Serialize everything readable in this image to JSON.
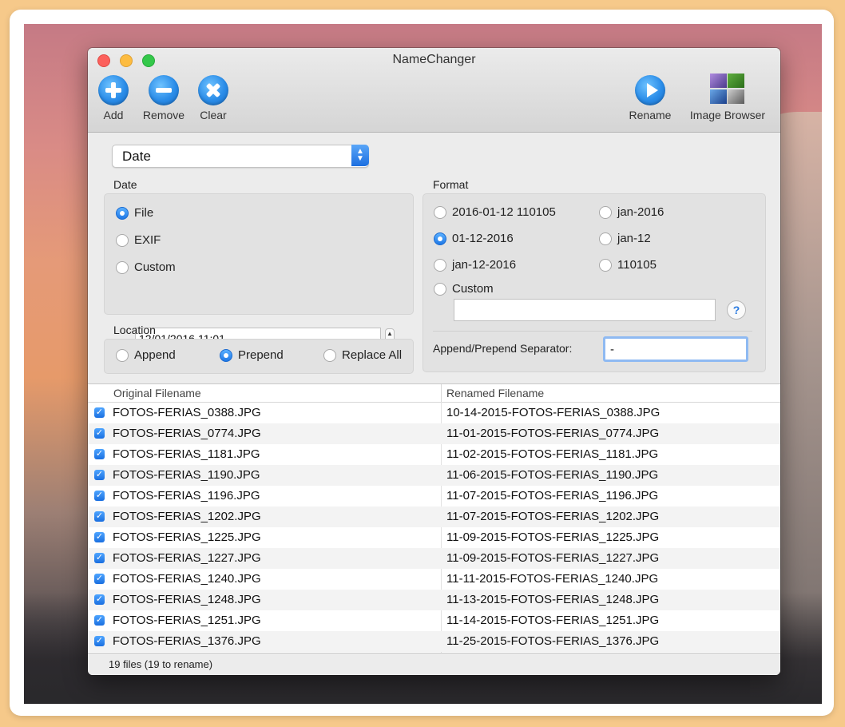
{
  "window": {
    "title": "NameChanger"
  },
  "toolbar": {
    "add": "Add",
    "remove": "Remove",
    "clear": "Clear",
    "rename": "Rename",
    "image_browser": "Image Browser"
  },
  "mode_select": {
    "value": "Date"
  },
  "date_section": {
    "label": "Date",
    "options": [
      "File",
      "EXIF",
      "Custom"
    ],
    "selected": "File",
    "custom_value": "12/01/2016 11:01"
  },
  "location_section": {
    "label": "Location",
    "options": [
      "Append",
      "Prepend",
      "Replace All"
    ],
    "selected": "Prepend"
  },
  "format_section": {
    "label": "Format",
    "options": [
      "2016-01-12 110105",
      "jan-2016",
      "01-12-2016",
      "jan-12",
      "jan-12-2016",
      "110105",
      "Custom"
    ],
    "selected": "01-12-2016",
    "custom_value": "",
    "help": "?"
  },
  "separator": {
    "label": "Append/Prepend Separator:",
    "value": "-"
  },
  "table": {
    "headers": [
      "Original Filename",
      "Renamed Filename"
    ],
    "rows": [
      {
        "original": "FOTOS-FERIAS_0388.JPG",
        "renamed": "10-14-2015-FOTOS-FERIAS_0388.JPG"
      },
      {
        "original": "FOTOS-FERIAS_0774.JPG",
        "renamed": "11-01-2015-FOTOS-FERIAS_0774.JPG"
      },
      {
        "original": "FOTOS-FERIAS_1181.JPG",
        "renamed": "11-02-2015-FOTOS-FERIAS_1181.JPG"
      },
      {
        "original": "FOTOS-FERIAS_1190.JPG",
        "renamed": "11-06-2015-FOTOS-FERIAS_1190.JPG"
      },
      {
        "original": "FOTOS-FERIAS_1196.JPG",
        "renamed": "11-07-2015-FOTOS-FERIAS_1196.JPG"
      },
      {
        "original": "FOTOS-FERIAS_1202.JPG",
        "renamed": "11-07-2015-FOTOS-FERIAS_1202.JPG"
      },
      {
        "original": "FOTOS-FERIAS_1225.JPG",
        "renamed": "11-09-2015-FOTOS-FERIAS_1225.JPG"
      },
      {
        "original": "FOTOS-FERIAS_1227.JPG",
        "renamed": "11-09-2015-FOTOS-FERIAS_1227.JPG"
      },
      {
        "original": "FOTOS-FERIAS_1240.JPG",
        "renamed": "11-11-2015-FOTOS-FERIAS_1240.JPG"
      },
      {
        "original": "FOTOS-FERIAS_1248.JPG",
        "renamed": "11-13-2015-FOTOS-FERIAS_1248.JPG"
      },
      {
        "original": "FOTOS-FERIAS_1251.JPG",
        "renamed": "11-14-2015-FOTOS-FERIAS_1251.JPG"
      },
      {
        "original": "FOTOS-FERIAS_1376.JPG",
        "renamed": "11-25-2015-FOTOS-FERIAS_1376.JPG"
      }
    ]
  },
  "status": {
    "text": "19 files (19 to rename)"
  },
  "icons": {
    "add": "plus-circle-icon",
    "remove": "minus-circle-icon",
    "clear": "x-circle-icon",
    "rename": "play-circle-icon",
    "image_browser": "photo-grid-icon"
  },
  "colors": {
    "accent": "#1f78e6"
  }
}
